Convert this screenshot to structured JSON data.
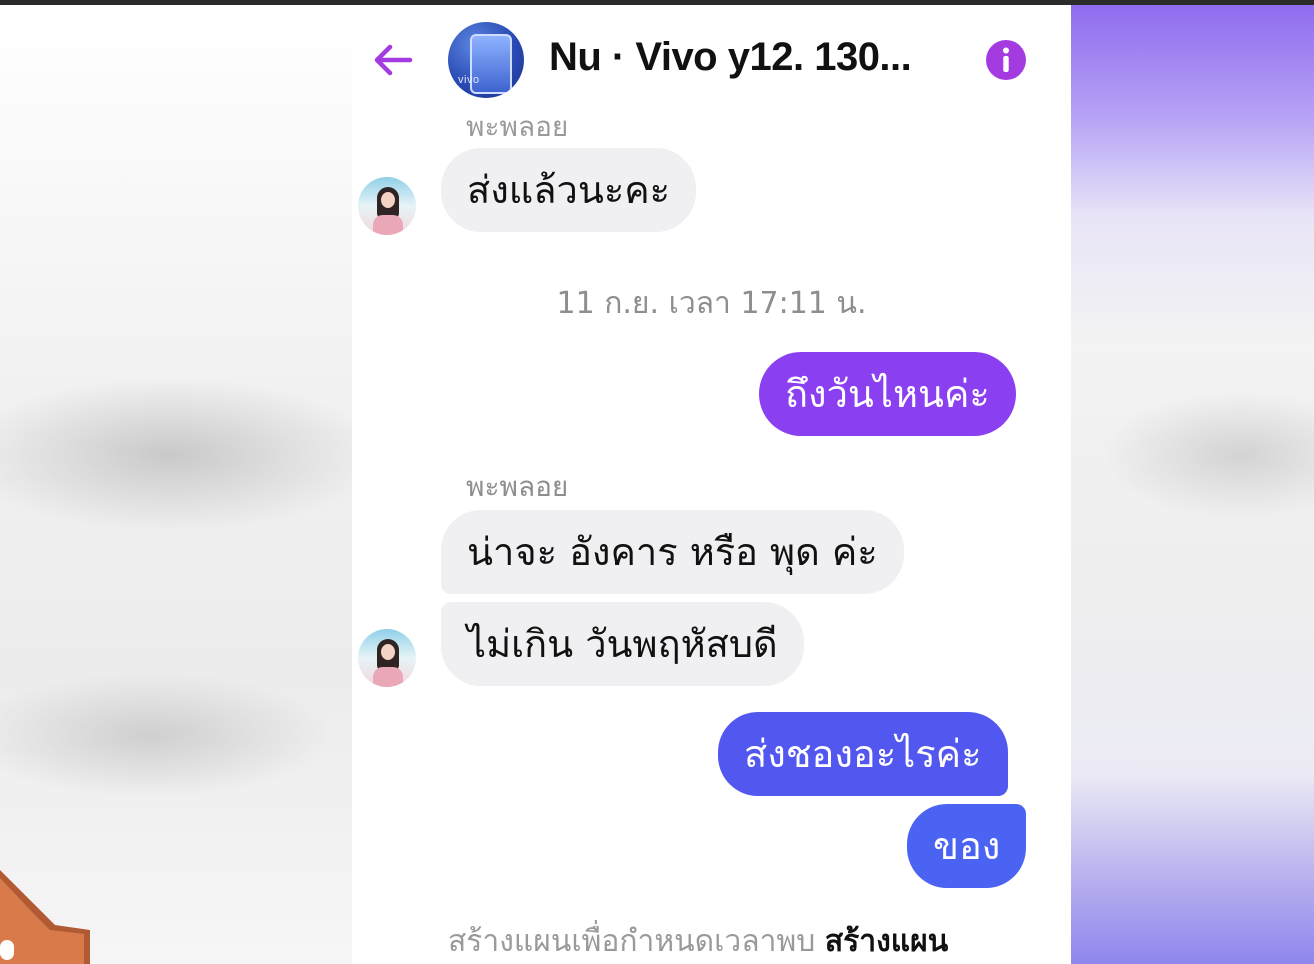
{
  "header": {
    "contact_name": "Nu · Vivo y12. 130...",
    "avatar_logo": "vivo"
  },
  "conversation": {
    "clipped_sender_name": "พะพลอย",
    "timestamp": "11 ก.ย. เวลา 17:11 น.",
    "sender_name": "พะพลอย",
    "messages": [
      {
        "direction": "incoming",
        "text": "ส่งแล้วนะคะ"
      },
      {
        "direction": "outgoing",
        "text": "ถึงวันไหนค่ะ"
      },
      {
        "direction": "incoming",
        "text": "น่าจะ อังคาร หรือ พุด ค่ะ"
      },
      {
        "direction": "incoming",
        "text": "ไม่เกิน วันพฤหัสบดี"
      },
      {
        "direction": "outgoing",
        "text": "ส่งชองอะไรค่ะ"
      },
      {
        "direction": "outgoing",
        "text": "ของ"
      }
    ]
  },
  "banner": {
    "text": "สร้างแผนเพื่อกำหนดเวลาพบ",
    "link": "สร้างแผน"
  },
  "colors": {
    "accent": "#a33be0",
    "outgoing_purple": "#8a3ff0",
    "outgoing_blue": "#4a63f2",
    "incoming_bubble": "#f0f0f2"
  },
  "icons": {
    "back": "arrow-left-icon",
    "info": "info-circle-icon"
  }
}
